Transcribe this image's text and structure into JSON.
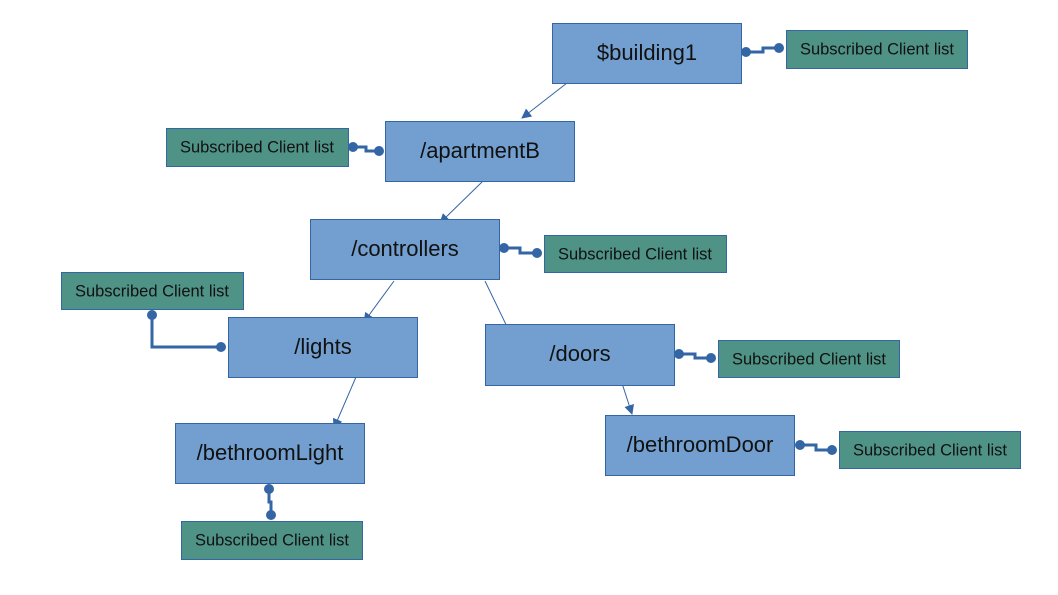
{
  "colors": {
    "node_fill": "#729fcf",
    "node_border": "#3465a4",
    "client_fill": "#4f9387",
    "connector": "#3465a4"
  },
  "nodes": {
    "building1": "$building1",
    "apartmentB": "/apartmentB",
    "controllers": "/controllers",
    "lights": "/lights",
    "doors": "/doors",
    "bethroomLight": "/bethroomLight",
    "bethroomDoor": "/bethroomDoor"
  },
  "client_list_label": "Subscribed Client list",
  "edges": [
    [
      "$building1",
      "/apartmentB"
    ],
    [
      "/apartmentB",
      "/controllers"
    ],
    [
      "/controllers",
      "/lights"
    ],
    [
      "/controllers",
      "/doors"
    ],
    [
      "/lights",
      "/bethroomLight"
    ],
    [
      "/doors",
      "/bethroomDoor"
    ]
  ]
}
